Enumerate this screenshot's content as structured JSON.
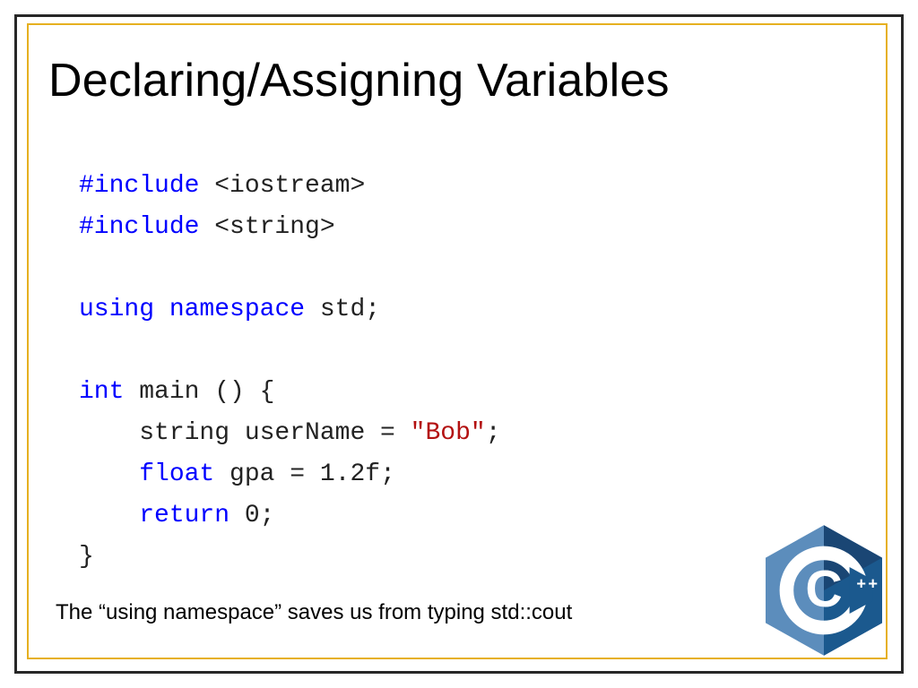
{
  "title": "Declaring/Assigning Variables",
  "code": {
    "l1_kw": "#include",
    "l1_rest": " <iostream>",
    "l2_kw": "#include",
    "l2_rest": " <string>",
    "l3_kw": "using",
    "l3_kw2": "namespace",
    "l3_rest": " std;",
    "l4_kw": "int",
    "l4_rest": " main () {",
    "l5_pre": "    string userName = ",
    "l5_str": "\"Bob\"",
    "l5_post": ";",
    "l6_pre": "    ",
    "l6_kw": "float",
    "l6_rest": " gpa = 1.2f;",
    "l7_pre": "    ",
    "l7_kw": "return",
    "l7_rest": " 0;",
    "l8": "}"
  },
  "caption": "The “using namespace” saves us from typing std::cout",
  "logo_name": "cpp-logo"
}
